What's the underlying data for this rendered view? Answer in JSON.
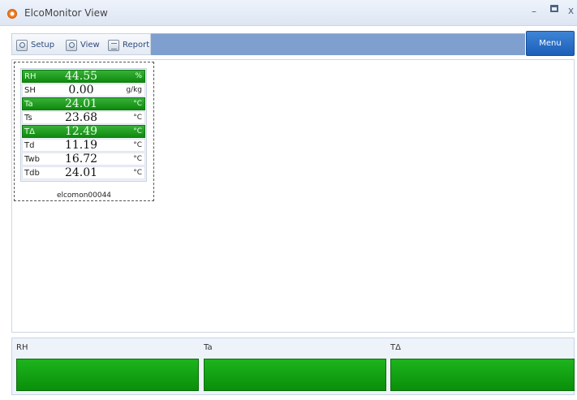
{
  "window": {
    "title": "ElcoMonitor View",
    "controls": {
      "minimize": "–",
      "maximize": "",
      "close": "x"
    }
  },
  "toolbar": {
    "setup_label": "Setup",
    "view_label": "View",
    "report_label": "Report",
    "menu_label": "Menu"
  },
  "device": {
    "id": "elcomon00044",
    "readings": [
      {
        "label": "RH",
        "value": "44.55",
        "unit": "%",
        "highlighted": true
      },
      {
        "label": "SH",
        "value": "0.00",
        "unit": "g/kg",
        "highlighted": false
      },
      {
        "label": "Ta",
        "value": "24.01",
        "unit": "°C",
        "highlighted": true
      },
      {
        "label": "Ts",
        "value": "23.68",
        "unit": "°C",
        "highlighted": false
      },
      {
        "label": "TΔ",
        "value": "12.49",
        "unit": "°C",
        "highlighted": true
      },
      {
        "label": "Td",
        "value": "11.19",
        "unit": "°C",
        "highlighted": false
      },
      {
        "label": "Twb",
        "value": "16.72",
        "unit": "°C",
        "highlighted": false
      },
      {
        "label": "Tdb",
        "value": "24.01",
        "unit": "°C",
        "highlighted": false
      }
    ]
  },
  "bottom_bars": [
    {
      "label": "RH"
    },
    {
      "label": "Ta"
    },
    {
      "label": "TΔ"
    }
  ],
  "colors": {
    "highlight_green": "#1db51d",
    "menu_blue": "#2a72c9",
    "toolbar_blue": "#7f9fcf"
  }
}
